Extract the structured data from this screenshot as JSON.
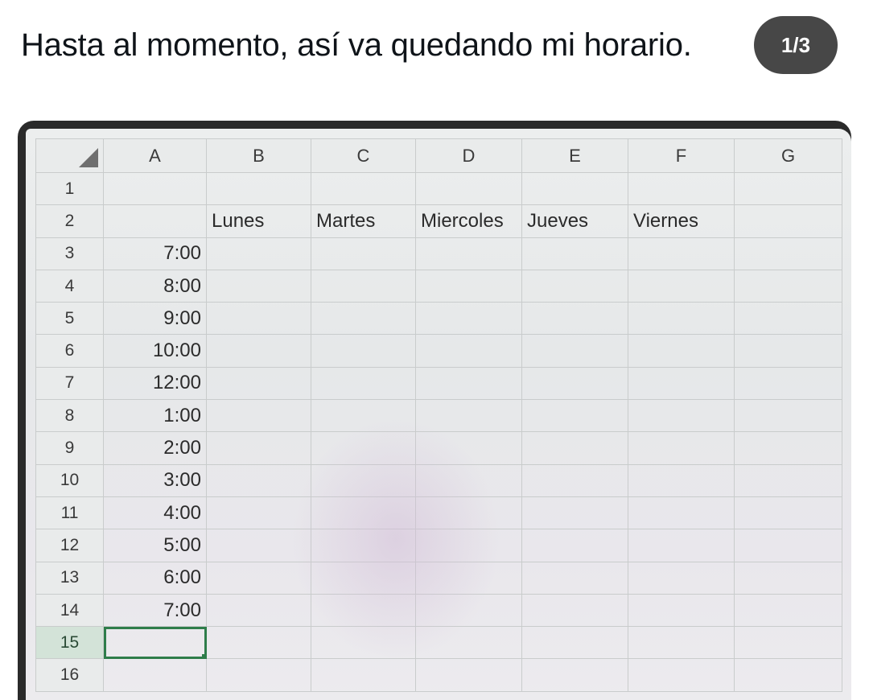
{
  "post": {
    "text": "Hasta al momento, así va quedando mi horario.",
    "counter": "1/3"
  },
  "spreadsheet": {
    "columns": [
      "A",
      "B",
      "C",
      "D",
      "E",
      "F",
      "G"
    ],
    "selected_column": "A",
    "selected_cell": "A15",
    "rows": [
      {
        "num": "1",
        "A": "",
        "B": "",
        "C": "",
        "D": "",
        "E": "",
        "F": "",
        "G": ""
      },
      {
        "num": "2",
        "A": "",
        "B": "Lunes",
        "C": "Martes",
        "D": "Miercoles",
        "E": "Jueves",
        "F": "Viernes",
        "G": ""
      },
      {
        "num": "3",
        "A": "7:00"
      },
      {
        "num": "4",
        "A": "8:00"
      },
      {
        "num": "5",
        "A": "9:00"
      },
      {
        "num": "6",
        "A": "10:00"
      },
      {
        "num": "7",
        "A": "12:00"
      },
      {
        "num": "8",
        "A": "1:00"
      },
      {
        "num": "9",
        "A": "2:00"
      },
      {
        "num": "10",
        "A": "3:00"
      },
      {
        "num": "11",
        "A": "4:00"
      },
      {
        "num": "12",
        "A": "5:00"
      },
      {
        "num": "13",
        "A": "6:00"
      },
      {
        "num": "14",
        "A": "7:00"
      },
      {
        "num": "15",
        "A": ""
      },
      {
        "num": "16",
        "A": ""
      }
    ]
  },
  "colors": {
    "selection_green": "#2e7d4a",
    "header_gray": "#e9ebeb"
  }
}
